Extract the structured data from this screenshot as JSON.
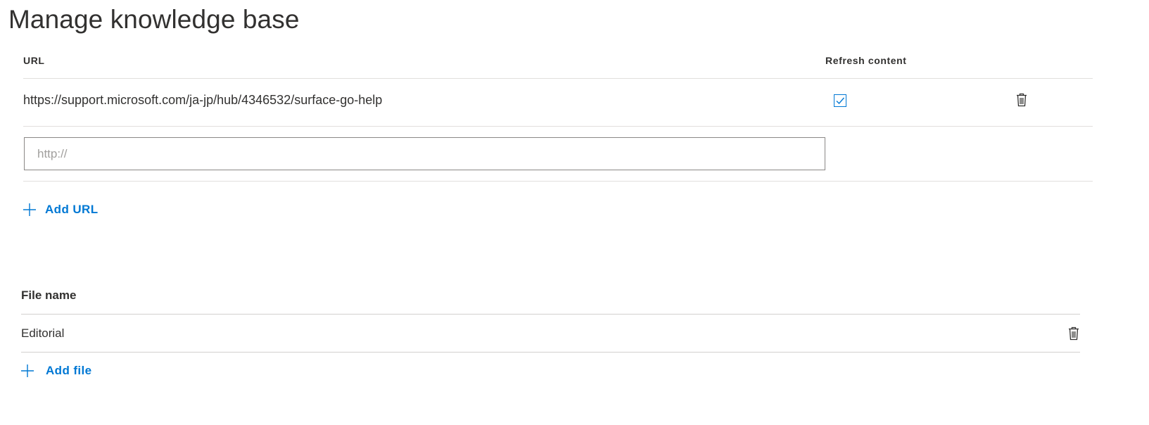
{
  "page": {
    "title": "Manage knowledge base"
  },
  "urls": {
    "col_url": "URL",
    "col_refresh": "Refresh content",
    "rows": [
      {
        "url": "https://support.microsoft.com/ja-jp/hub/4346532/surface-go-help",
        "refresh_content": true
      }
    ],
    "input_placeholder": "http://",
    "input_value": "",
    "add_label": "Add URL"
  },
  "files": {
    "col_file": "File name",
    "rows": [
      {
        "name": "Editorial"
      }
    ],
    "add_label": "Add file"
  },
  "colors": {
    "accent": "#0078d4",
    "text": "#323130",
    "divider": "#e1dfdd",
    "input_border": "#8a8886",
    "placeholder": "#a19f9d"
  },
  "icons": {
    "delete": "trash-icon",
    "add": "plus-icon",
    "check": "checkmark-icon"
  }
}
